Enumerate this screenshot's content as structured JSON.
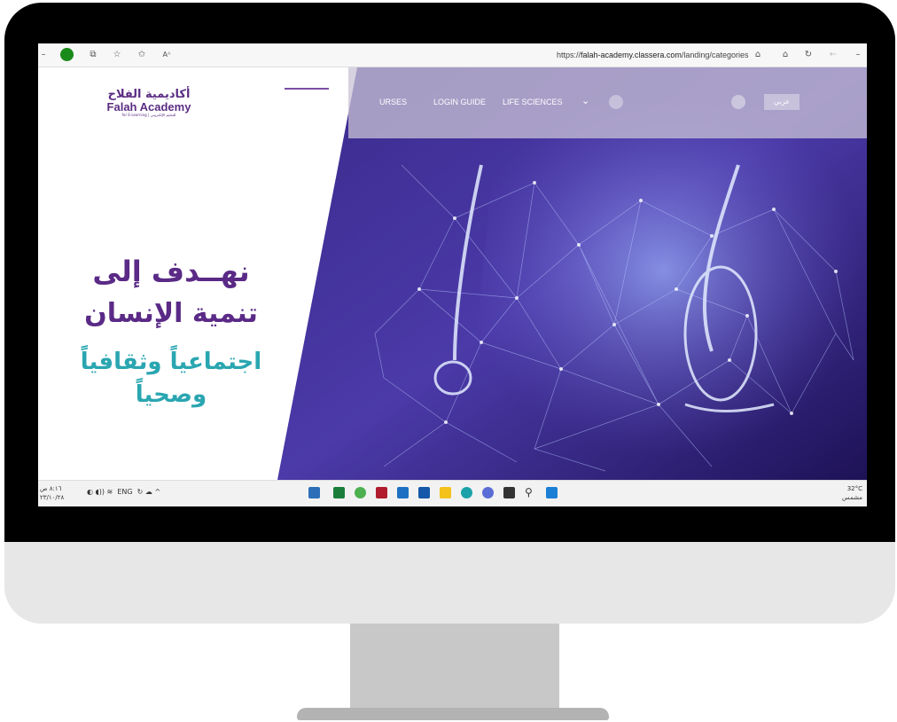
{
  "browser": {
    "url_prefix": "https://",
    "url_host": "falah-academy.classera.com",
    "url_path": "/landing/categories",
    "read_aloud": "Aᴬ"
  },
  "site": {
    "logo_ar": "أكاديمية الفلاح",
    "logo_en": "Falah Academy",
    "logo_sub": "for E-Learning | للتعليم الإلكتروني",
    "nav": [
      "URSES",
      "LOGIN GUIDE",
      "LIFE SCIENCES"
    ],
    "lang_button": "عربي"
  },
  "hero": {
    "line1": "نهــدف إلى",
    "line2": "تنمية الإنسان",
    "line3": "اجتماعياً وثقافياً",
    "line4": "وصحياً"
  },
  "taskbar": {
    "time": "٨:١٦ ص",
    "date": "٢٣/١٠/٢٨",
    "lang": "ENG",
    "temperature": "32°C",
    "weather": "مشمس"
  },
  "colors": {
    "brand_purple": "#5a2a86",
    "teal": "#2aa6b1",
    "hero_deep": "#2b1a6b"
  }
}
